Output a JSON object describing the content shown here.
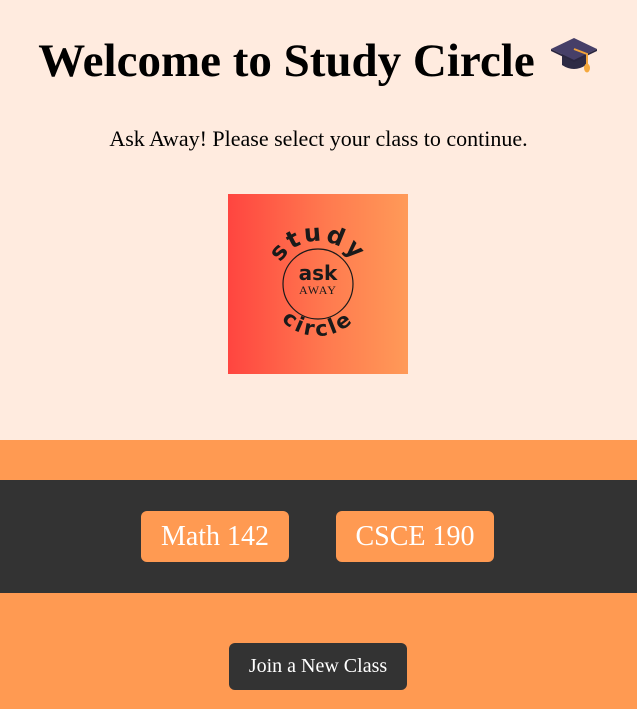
{
  "header": {
    "title": "Welcome to Study Circle",
    "title_icon": "graduation-cap-icon",
    "subtitle": "Ask Away! Please select your class to continue."
  },
  "logo": {
    "arc_top": "study",
    "center_main": "ask",
    "center_sub": "AWAY",
    "arc_bottom": "circle"
  },
  "classes": [
    {
      "label": "Math 142"
    },
    {
      "label": "CSCE 190"
    }
  ],
  "join_button": {
    "label": "Join a New Class"
  },
  "colors": {
    "background_top": "#ffebdf",
    "accent_orange": "#ff9a52",
    "dark_band": "#333333",
    "logo_gradient_start": "#ff4540",
    "logo_gradient_end": "#ff9a58"
  }
}
